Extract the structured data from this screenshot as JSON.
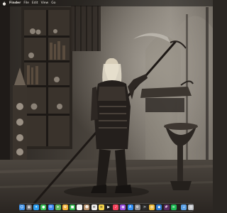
{
  "menubar": {
    "app_name": "Finder",
    "items": [
      "File",
      "Edit",
      "View",
      "Go"
    ]
  },
  "wallpaper": {
    "subject": "necromancer-with-scythe-wallpaper"
  },
  "dock": {
    "apps": [
      {
        "name": "finder-icon",
        "color": "#3a8ee6",
        "glyph": "☺"
      },
      {
        "name": "launchpad-icon",
        "color": "#6c6c70",
        "glyph": "▦"
      },
      {
        "name": "safari-icon",
        "color": "#2c9df0",
        "glyph": "✦"
      },
      {
        "name": "messages-icon",
        "color": "#38c25a",
        "glyph": "●"
      },
      {
        "name": "mail-icon",
        "color": "#3b86f0",
        "glyph": "✉"
      },
      {
        "name": "maps-icon",
        "color": "#5fb85b",
        "glyph": "➤"
      },
      {
        "name": "photos-icon",
        "color": "#f2b13a",
        "glyph": "✿"
      },
      {
        "name": "facetime-icon",
        "color": "#2fb24c",
        "glyph": "■"
      },
      {
        "name": "calendar-icon",
        "color": "#f1f1f1",
        "glyph": ""
      },
      {
        "name": "contacts-icon",
        "color": "#b8906a",
        "glyph": "☻"
      },
      {
        "name": "reminders-icon",
        "color": "#ececec",
        "glyph": "≡"
      },
      {
        "name": "notes-icon",
        "color": "#f5d34a",
        "glyph": "≡"
      },
      {
        "name": "tv-icon",
        "color": "#1c1c1e",
        "glyph": "▶"
      },
      {
        "name": "music-icon",
        "color": "#f2415b",
        "glyph": "♪"
      },
      {
        "name": "podcasts-icon",
        "color": "#9a4fe0",
        "glyph": "◉"
      },
      {
        "name": "app-store-icon",
        "color": "#2f8cf2",
        "glyph": "A"
      },
      {
        "name": "system-settings-icon",
        "color": "#8e8e93",
        "glyph": "⚙"
      },
      {
        "name": "terminal-icon",
        "color": "#2b2b2b",
        "glyph": ">"
      },
      {
        "name": "chrome-icon",
        "color": "#e9b73a",
        "glyph": "◍"
      },
      {
        "name": "vscode-icon",
        "color": "#2d7cd6",
        "glyph": "◆"
      },
      {
        "name": "slack-icon",
        "color": "#5a2a63",
        "glyph": "#"
      },
      {
        "name": "spotify-icon",
        "color": "#1db954",
        "glyph": "≋"
      }
    ],
    "trailing": [
      {
        "name": "downloads-folder-icon",
        "color": "#5aa0e6",
        "glyph": "↓"
      },
      {
        "name": "trash-icon",
        "color": "#b9bcc2",
        "glyph": "▥"
      }
    ]
  }
}
